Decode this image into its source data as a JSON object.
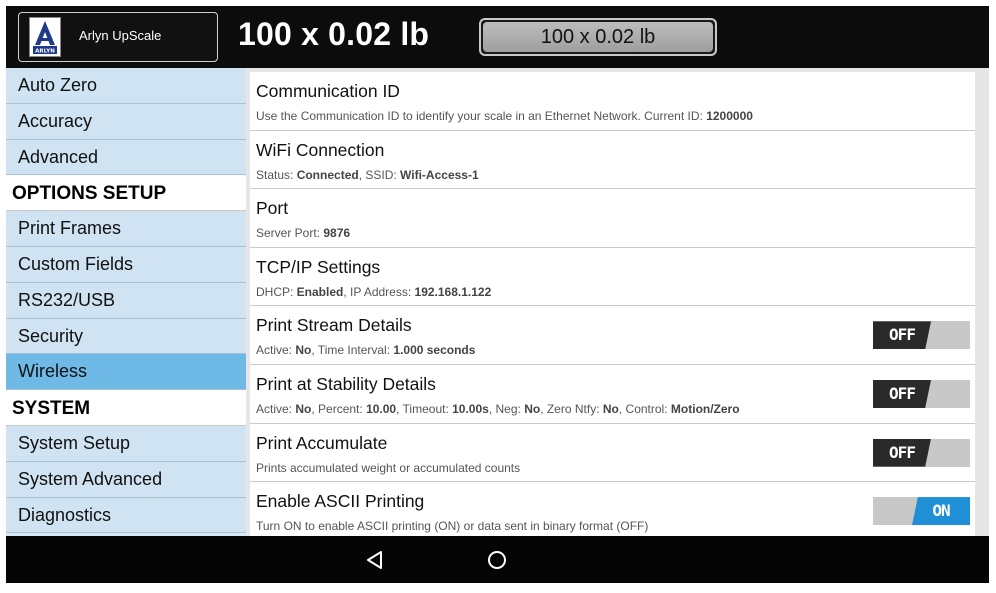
{
  "header": {
    "app_name": "Arlyn UpScale",
    "logo_caption": "ARLYN",
    "weight_display": "100 x 0.02 lb",
    "weight_box": "100 x 0.02 lb"
  },
  "sidebar": {
    "items": [
      {
        "label": "Auto Zero",
        "type": "item"
      },
      {
        "label": "Accuracy",
        "type": "item"
      },
      {
        "label": "Advanced",
        "type": "item"
      },
      {
        "label": "OPTIONS SETUP",
        "type": "header"
      },
      {
        "label": "Print Frames",
        "type": "item"
      },
      {
        "label": "Custom Fields",
        "type": "item"
      },
      {
        "label": "RS232/USB",
        "type": "item"
      },
      {
        "label": "Security",
        "type": "item"
      },
      {
        "label": "Wireless",
        "type": "item",
        "selected": true
      },
      {
        "label": "SYSTEM",
        "type": "header"
      },
      {
        "label": "System Setup",
        "type": "item"
      },
      {
        "label": "System Advanced",
        "type": "item"
      },
      {
        "label": "Diagnostics",
        "type": "item"
      }
    ]
  },
  "settings": {
    "communication_id": {
      "title": "Communication ID",
      "sub_prefix": "Use the Communication ID to identify your scale in an Ethernet Network. Current ID: ",
      "current_id": "1200000"
    },
    "wifi_connection": {
      "title": "WiFi Connection",
      "status_label": "Status: ",
      "status_value": "Connected",
      "ssid_label": ", SSID: ",
      "ssid_value": "Wifi-Access-1"
    },
    "port": {
      "title": "Port",
      "port_label": "Server Port: ",
      "port_value": "9876"
    },
    "tcpip": {
      "title": "TCP/IP Settings",
      "dhcp_label": "DHCP: ",
      "dhcp_value": "Enabled",
      "ip_label": ", IP Address: ",
      "ip_value": "192.168.1.122"
    },
    "print_stream": {
      "title": "Print Stream Details",
      "active_label": "Active: ",
      "active_value": "No",
      "interval_label": ", Time Interval: ",
      "interval_value": "1.000 seconds",
      "toggle": "OFF"
    },
    "print_stability": {
      "title": "Print at Stability Details",
      "active_label": "Active: ",
      "active_value": "No",
      "percent_label": ", Percent: ",
      "percent_value": "10.00",
      "timeout_label": ", Timeout: ",
      "timeout_value": "10.00s",
      "neg_label": ", Neg: ",
      "neg_value": "No",
      "zero_label": ", Zero Ntfy: ",
      "zero_value": "No",
      "control_label": ", Control: ",
      "control_value": "Motion/Zero",
      "toggle": "OFF"
    },
    "print_accumulate": {
      "title": "Print Accumulate",
      "sub": "Prints accumulated weight or accumulated counts",
      "toggle": "OFF"
    },
    "ascii_printing": {
      "title": "Enable ASCII Printing",
      "sub": "Turn ON to enable ASCII printing (ON) or data sent in binary format (OFF)",
      "toggle": "ON"
    }
  },
  "navbar": {
    "back_icon": "back-triangle-icon",
    "home_icon": "home-circle-icon"
  },
  "colors": {
    "sidebar_bg": "#cfe3f2",
    "sidebar_selected": "#6fb9e6",
    "toggle_on": "#1f8fd6",
    "toggle_off": "#2a2a2a"
  }
}
